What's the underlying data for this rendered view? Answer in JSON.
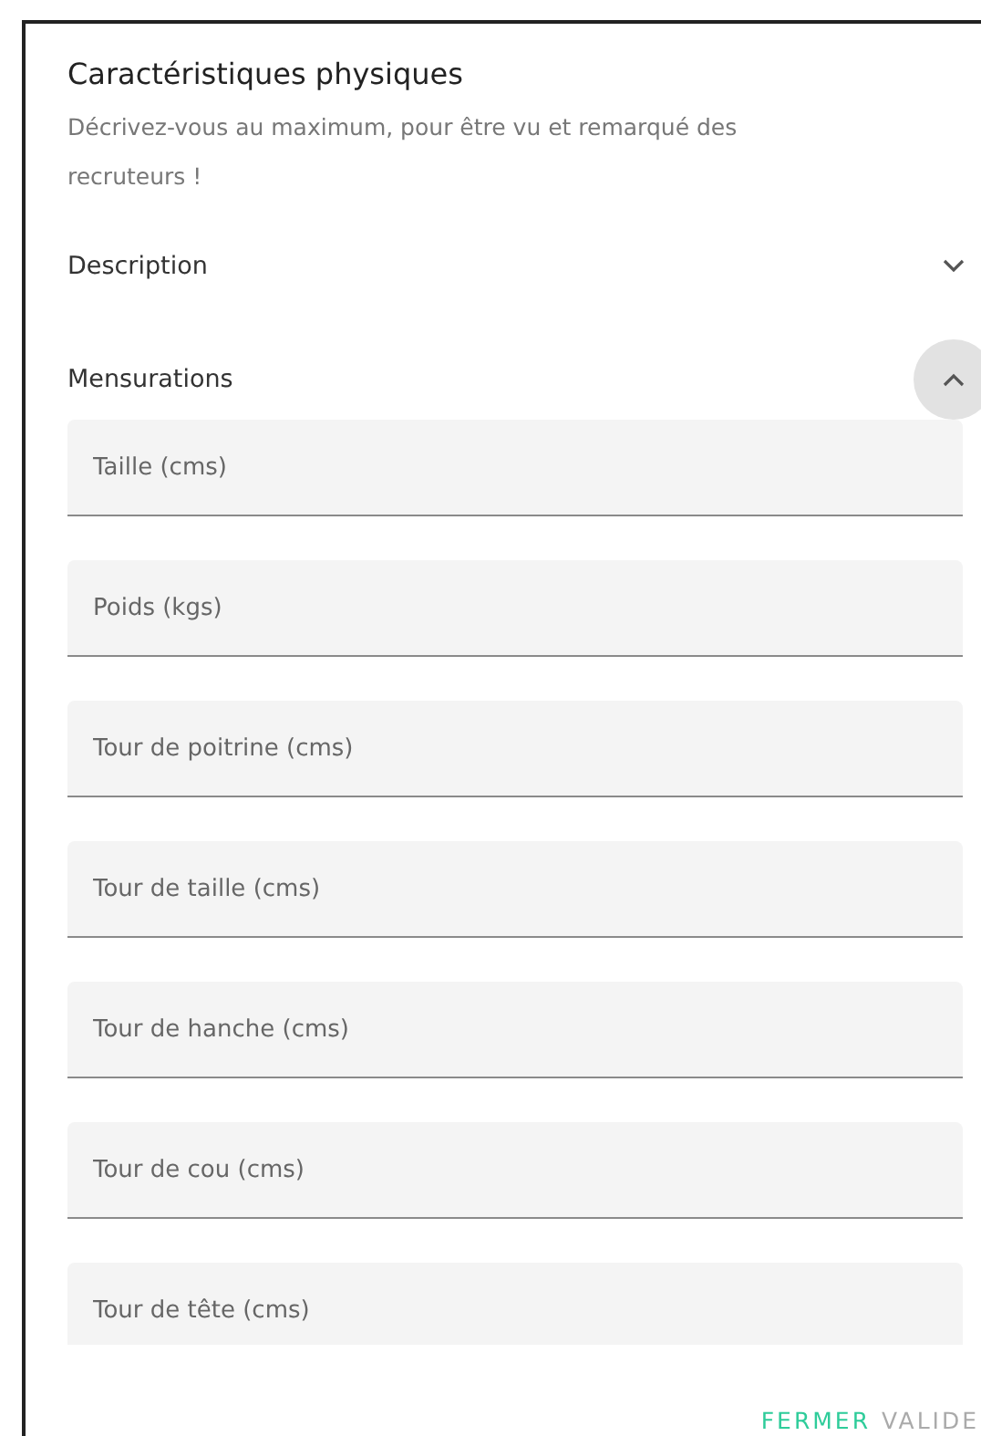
{
  "dialog": {
    "title": "Caractéristiques physiques",
    "subtitle": "Décrivez-vous au maximum, pour être vu et remarqué des recruteurs !",
    "sections": [
      {
        "label": "Description",
        "expanded": false
      },
      {
        "label": "Mensurations",
        "expanded": true,
        "fields": [
          {
            "placeholder": "Taille (cms)"
          },
          {
            "placeholder": "Poids (kgs)"
          },
          {
            "placeholder": "Tour de poitrine (cms)"
          },
          {
            "placeholder": "Tour de taille (cms)"
          },
          {
            "placeholder": "Tour de hanche (cms)"
          },
          {
            "placeholder": "Tour de cou (cms)"
          },
          {
            "placeholder": "Tour de tête (cms)"
          }
        ]
      }
    ],
    "buttons": [
      {
        "label": "FERMER",
        "kind": "primary"
      },
      {
        "label": "VALIDE",
        "kind": "disabled"
      }
    ]
  }
}
